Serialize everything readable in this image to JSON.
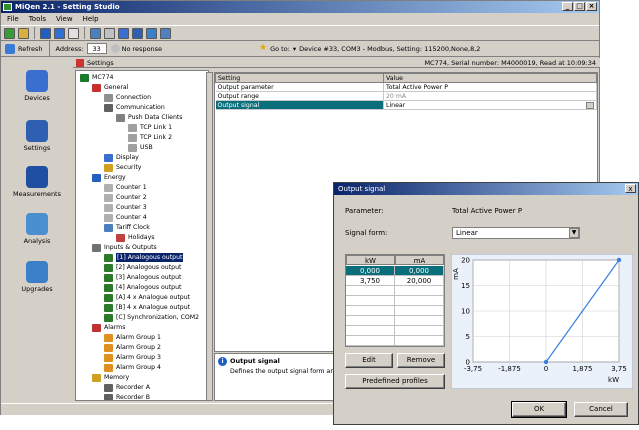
{
  "app": {
    "title": "MiQen 2.1 - Setting Studio"
  },
  "menu": [
    "File",
    "Tools",
    "View",
    "Help"
  ],
  "address_bar": {
    "refresh_label": "Refresh",
    "address_label": "Address:",
    "address_value": "33",
    "response": "No response",
    "goto_label": "Go to:",
    "device": "Device #33, COM3 - Modbus, Setting: 115200,None,8,2"
  },
  "sidebar": [
    {
      "label": "Devices",
      "icon": "devices-icon",
      "color": "#3a6fcf"
    },
    {
      "label": "Settings",
      "icon": "settings-icon",
      "color": "#2f5fb0"
    },
    {
      "label": "Measurements",
      "icon": "measurements-icon",
      "color": "#1f4fa0"
    },
    {
      "label": "Analysis",
      "icon": "analysis-icon",
      "color": "#4a8fd0"
    },
    {
      "label": "Upgrades",
      "icon": "upgrades-icon",
      "color": "#3a7fc8"
    }
  ],
  "settings": {
    "header": "Settings",
    "serial_info": "MC774, Serial number: M4000019, Read at 10:09:34",
    "tree": [
      {
        "label": "MC774",
        "level": 0,
        "color": "#1a7a2a"
      },
      {
        "label": "General",
        "level": 1,
        "color": "#c83030"
      },
      {
        "label": "Connection",
        "level": 2,
        "color": "#909090"
      },
      {
        "label": "Communication",
        "level": 2,
        "color": "#606060"
      },
      {
        "label": "Push Data Clients",
        "level": 3,
        "color": "#808080"
      },
      {
        "label": "TCP Link 1",
        "level": 4,
        "color": "#a0a0a0"
      },
      {
        "label": "TCP Link 2",
        "level": 4,
        "color": "#a0a0a0"
      },
      {
        "label": "USB",
        "level": 4,
        "color": "#a0a0a0"
      },
      {
        "label": "Display",
        "level": 2,
        "color": "#3a6fcf"
      },
      {
        "label": "Security",
        "level": 2,
        "color": "#d0a020"
      },
      {
        "label": "Energy",
        "level": 1,
        "color": "#2060c0"
      },
      {
        "label": "Counter 1",
        "level": 2,
        "color": "#b0b0b0"
      },
      {
        "label": "Counter 2",
        "level": 2,
        "color": "#b0b0b0"
      },
      {
        "label": "Counter 3",
        "level": 2,
        "color": "#b0b0b0"
      },
      {
        "label": "Counter 4",
        "level": 2,
        "color": "#b0b0b0"
      },
      {
        "label": "Tariff Clock",
        "level": 2,
        "color": "#4a7fc0"
      },
      {
        "label": "Holidays",
        "level": 3,
        "color": "#c04040"
      },
      {
        "label": "Inputs & Outputs",
        "level": 1,
        "color": "#707070"
      },
      {
        "label": "[1] Analogous output",
        "level": 2,
        "color": "#2a7a2a",
        "selected": true
      },
      {
        "label": "[2] Analogous output",
        "level": 2,
        "color": "#2a7a2a"
      },
      {
        "label": "[3] Analogous output",
        "level": 2,
        "color": "#2a7a2a"
      },
      {
        "label": "[4] Analogous output",
        "level": 2,
        "color": "#2a7a2a"
      },
      {
        "label": "[A] 4 x Analogue output",
        "level": 2,
        "color": "#2a7a2a"
      },
      {
        "label": "[B] 4 x Analogue output",
        "level": 2,
        "color": "#2a7a2a"
      },
      {
        "label": "[C] Synchronization, COM2",
        "level": 2,
        "color": "#2a7a2a"
      },
      {
        "label": "Alarms",
        "level": 1,
        "color": "#c03030"
      },
      {
        "label": "Alarm Group 1",
        "level": 2,
        "color": "#e09020"
      },
      {
        "label": "Alarm Group 2",
        "level": 2,
        "color": "#e09020"
      },
      {
        "label": "Alarm Group 3",
        "level": 2,
        "color": "#e09020"
      },
      {
        "label": "Alarm Group 4",
        "level": 2,
        "color": "#e09020"
      },
      {
        "label": "Memory",
        "level": 1,
        "color": "#d0a020"
      },
      {
        "label": "Recorder A",
        "level": 2,
        "color": "#606060"
      },
      {
        "label": "Recorder B",
        "level": 2,
        "color": "#606060"
      }
    ],
    "table_headers": [
      "Setting",
      "Value"
    ],
    "rows": [
      {
        "setting": "Output parameter",
        "value": "Total Active Power P",
        "grey": false,
        "selected": false
      },
      {
        "setting": "Output range",
        "value": "20 mA",
        "grey": true,
        "selected": false
      },
      {
        "setting": "Output signal",
        "value": "Linear",
        "grey": false,
        "selected": true
      }
    ],
    "description": {
      "title": "Output signal",
      "text": "Defines the output signal form and op"
    }
  },
  "dialog": {
    "title": "Output signal",
    "close": "x",
    "parameter_label": "Parameter:",
    "parameter_value": "Total Active Power P",
    "signal_form_label": "Signal form:",
    "signal_form_value": "Linear",
    "grid_headers": [
      "kW",
      "mA"
    ],
    "grid_rows": [
      [
        "0,000",
        "0,000"
      ],
      [
        "3,750",
        "20,000"
      ]
    ],
    "edit_label": "Edit",
    "remove_label": "Remove",
    "profiles_label": "Predefined profiles",
    "ok_label": "OK",
    "cancel_label": "Cancel"
  },
  "chart_data": {
    "type": "line",
    "xlabel": "kW",
    "ylabel": "mA",
    "x_ticks": [
      "-3,75",
      "-1,875",
      "0",
      "1,875",
      "3,75"
    ],
    "x_tick_values": [
      -3.75,
      -1.875,
      0,
      1.875,
      3.75
    ],
    "y_ticks": [
      "0",
      "5",
      "10",
      "15",
      "20"
    ],
    "y_tick_values": [
      0,
      5,
      10,
      15,
      20
    ],
    "xlim": [
      -3.75,
      3.75
    ],
    "ylim": [
      0,
      20
    ],
    "grid": true,
    "series": [
      {
        "x": [
          0,
          3.75
        ],
        "y": [
          0,
          20
        ],
        "color": "#3a7fe0"
      }
    ]
  }
}
